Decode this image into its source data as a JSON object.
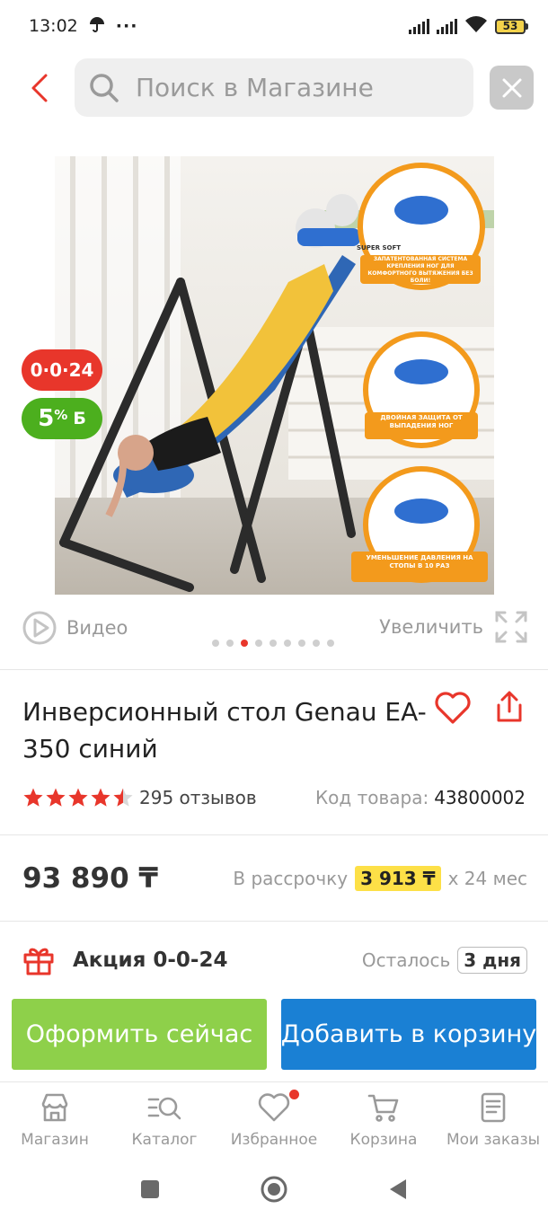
{
  "status_bar": {
    "time": "13:02",
    "battery": "53"
  },
  "search": {
    "placeholder": "Поиск в Магазине"
  },
  "badges": {
    "promo": "0·0·24",
    "bonus_percent": "5",
    "bonus_sign": "%",
    "bonus_unit": "Б"
  },
  "media": {
    "video_label": "Видео",
    "zoom_label": "Увеличить",
    "slide_count": 9,
    "active_slide": 2
  },
  "product": {
    "title": "Инверсионный стол Genau EA-350 синий",
    "rating": 4.5,
    "reviews": "295 отзывов",
    "sku_label": "Код товара:",
    "sku": "43800002",
    "price": "93 890 ₸",
    "installment_label": "В рассрочку",
    "installment_amount": "3 913 ₸",
    "installment_term": "х 24 мес"
  },
  "promo": {
    "title": "Акция 0-0-24",
    "remaining_label": "Осталось",
    "remaining_value": "3 дня"
  },
  "actions": {
    "buy_now": "Оформить сейчас",
    "add_to_cart": "Добавить в корзину"
  },
  "nav": {
    "items": [
      {
        "label": "Магазин",
        "icon": "store-icon"
      },
      {
        "label": "Каталог",
        "icon": "catalog-search-icon"
      },
      {
        "label": "Избранное",
        "icon": "heart-icon"
      },
      {
        "label": "Корзина",
        "icon": "cart-icon"
      },
      {
        "label": "Мои заказы",
        "icon": "orders-icon"
      }
    ]
  },
  "image_texts": {
    "super_soft": "SUPER SOFT",
    "caption_1": "ЗАПАТЕНТОВАННАЯ СИСТЕМА КРЕПЛЕНИЯ НОГ ДЛЯ КОМФОРТНОГО ВЫТЯЖЕНИЯ БЕЗ БОЛИ!",
    "caption_2": "ДВОЙНАЯ ЗАЩИТА ОТ ВЫПАДЕНИЯ НОГ",
    "caption_3": "УМЕНЬШЕНИЕ ДАВЛЕНИЯ НА СТОПЫ В 10 РАЗ"
  },
  "colors": {
    "accent": "#e8362b",
    "buy": "#8ed04a",
    "cart": "#1a80d4",
    "highlight": "#fde047"
  }
}
